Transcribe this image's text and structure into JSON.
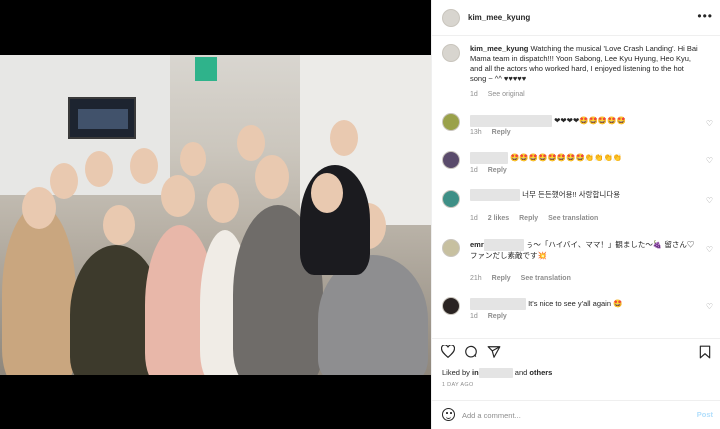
{
  "header": {
    "username": "kim_mee_kyung"
  },
  "caption": {
    "username": "kim_mee_kyung",
    "text": "Watching the musical 'Love Crash Landing'. Hi Bai Mama team in dispatch!!! Yoon Sabong, Lee Kyu Hyung, Heo Kyu, and all the actors who worked hard, I enjoyed listening to the hot song ~ ^^ ♥♥♥♥♥",
    "time": "1d",
    "see_original": "See original"
  },
  "comments": [
    {
      "text": "❤❤❤❤🤩🤩🤩🤩🤩",
      "time": "13h",
      "reply": "Reply"
    },
    {
      "text": "🤩🤩🤩🤩🤩🤩🤩🤩👏👏👏👏",
      "time": "1d",
      "reply": "Reply"
    },
    {
      "text": "너무 든든했어용!! 사랑합니다용",
      "time": "1d",
      "likes": "2 likes",
      "reply": "Reply",
      "translate": "See translation"
    },
    {
      "username": "emr",
      "text": "ぅ〜「ハイバイ、ママ！」観ました〜🍇 留さん♡ファンだし素敵です💥",
      "time": "21h",
      "reply": "Reply",
      "translate": "See translation"
    },
    {
      "text": "It's nice to see y'all again 🤩",
      "time": "1d",
      "reply": "Reply"
    }
  ],
  "likes": {
    "prefix": "Liked by",
    "user": "in",
    "and": "and",
    "others": "others"
  },
  "time_ago": "1 DAY AGO",
  "add_comment": {
    "placeholder": "Add a comment...",
    "post_label": "Post"
  },
  "icons": [
    "more-icon",
    "heart-icon",
    "comment-icon",
    "share-icon",
    "save-icon",
    "emoji-icon"
  ]
}
